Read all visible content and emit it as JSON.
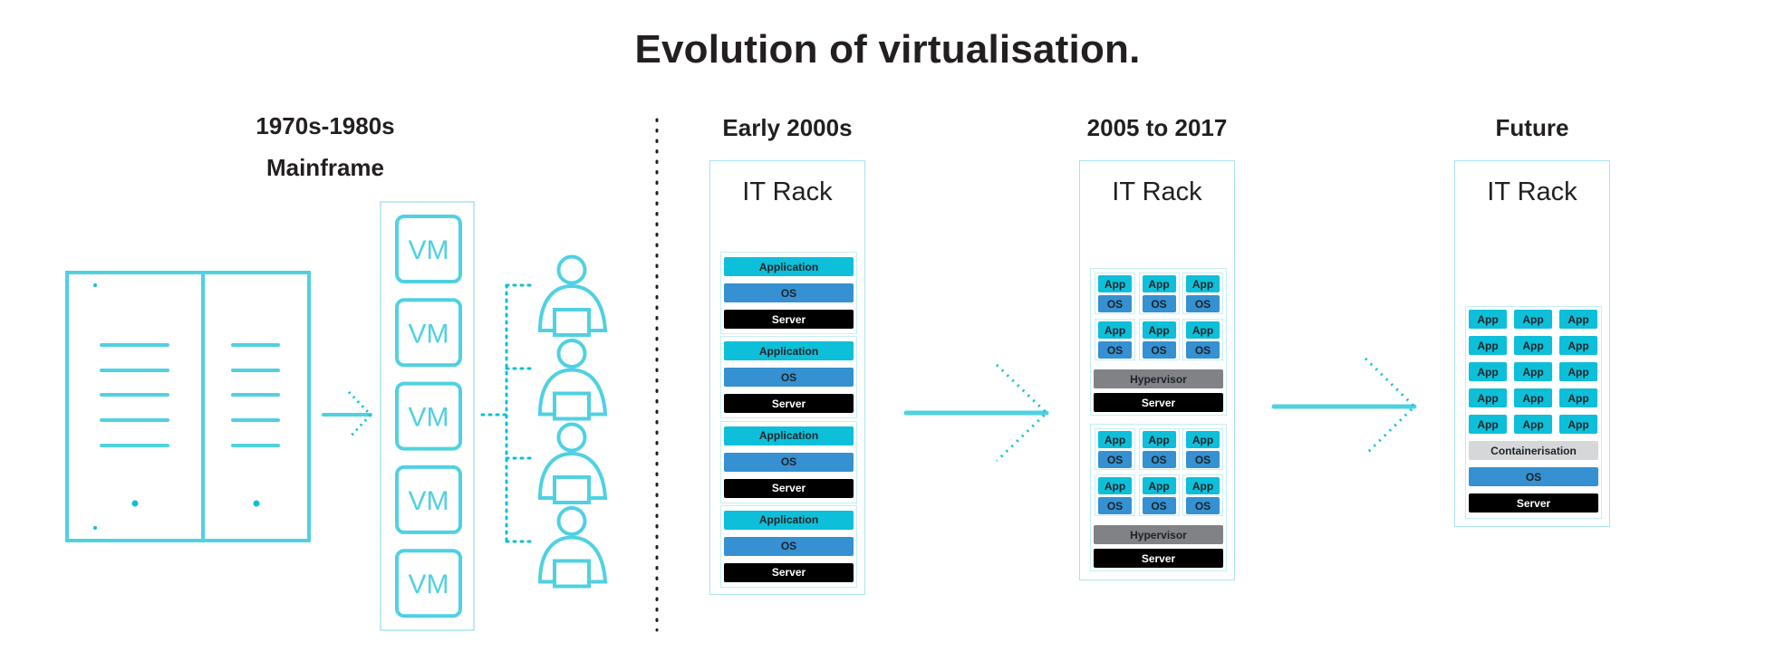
{
  "title": "Evolution of virtualisation.",
  "colors": {
    "accent": "#4fd1e2",
    "app": "#0dbfd8",
    "os": "#3591d1",
    "server": "#000000",
    "hypervisor": "#808285",
    "containerisation": "#d6d7d8",
    "rack_border": "#a9e4ee",
    "divider": "#231f20"
  },
  "eras": [
    {
      "heading": "1970s-1980s",
      "subheading": "Mainframe",
      "mainframe_icon": "mainframe-server-icon",
      "vm_label": "VM",
      "vms": [
        "VM",
        "VM",
        "VM",
        "VM",
        "VM"
      ],
      "users": [
        "user-icon",
        "user-icon",
        "user-icon",
        "user-icon"
      ]
    },
    {
      "heading": "Early 2000s",
      "rack_title": "IT Rack",
      "stacks": [
        {
          "layers": [
            "Application",
            "OS",
            "Server"
          ]
        },
        {
          "layers": [
            "Application",
            "OS",
            "Server"
          ]
        },
        {
          "layers": [
            "Application",
            "OS",
            "Server"
          ]
        },
        {
          "layers": [
            "Application",
            "OS",
            "Server"
          ]
        }
      ]
    },
    {
      "heading": "2005 to 2017",
      "rack_title": "IT Rack",
      "hosts": [
        {
          "vms": [
            [
              "App",
              "OS"
            ],
            [
              "App",
              "OS"
            ],
            [
              "App",
              "OS"
            ],
            [
              "App",
              "OS"
            ],
            [
              "App",
              "OS"
            ],
            [
              "App",
              "OS"
            ]
          ],
          "hypervisor": "Hypervisor",
          "server": "Server"
        },
        {
          "vms": [
            [
              "App",
              "OS"
            ],
            [
              "App",
              "OS"
            ],
            [
              "App",
              "OS"
            ],
            [
              "App",
              "OS"
            ],
            [
              "App",
              "OS"
            ],
            [
              "App",
              "OS"
            ]
          ],
          "hypervisor": "Hypervisor",
          "server": "Server"
        }
      ]
    },
    {
      "heading": "Future",
      "rack_title": "IT Rack",
      "apps": [
        "App",
        "App",
        "App",
        "App",
        "App",
        "App",
        "App",
        "App",
        "App",
        "App",
        "App",
        "App",
        "App",
        "App",
        "App"
      ],
      "containerisation": "Containerisation",
      "os": "OS",
      "server": "Server"
    }
  ]
}
